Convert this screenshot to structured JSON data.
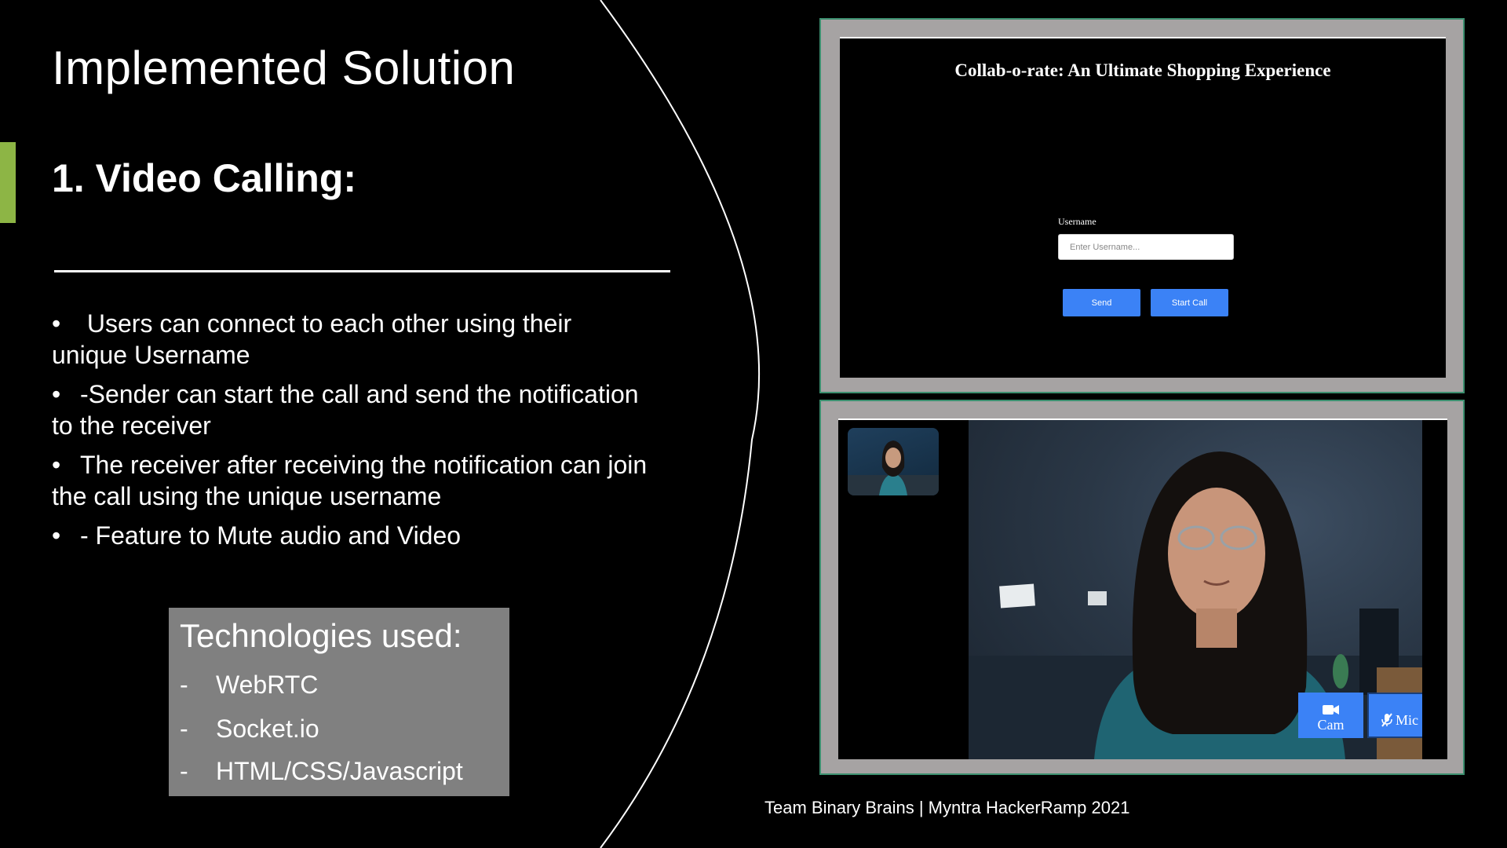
{
  "slide": {
    "title": "Implemented Solution",
    "subtitle": "1. Video Calling:",
    "bullets": [
      "  Users can connect to each other using their unique Username",
      "-Sender can start the call and send the notification to the receiver",
      "The receiver after receiving the notification can join the call using the unique username",
      "- Feature to Mute audio and Video"
    ],
    "bullet_char": "•",
    "tech": {
      "title": "Technologies used:",
      "items": [
        "WebRTC",
        "Socket.io",
        "HTML/CSS/Javascript"
      ],
      "dash": "-"
    },
    "footer": "Team Binary Brains | Myntra HackerRamp 2021"
  },
  "login_screen": {
    "title": "Collab-o-rate: An Ultimate Shopping Experience",
    "username_label": "Username",
    "username_placeholder": "Enter Username...",
    "send_label": "Send",
    "start_call_label": "Start Call"
  },
  "call_screen": {
    "cam_label": "Cam",
    "mic_label": "Mic",
    "cam_icon": "video-camera-icon",
    "mic_icon": "microphone-muted-icon"
  },
  "colors": {
    "accent": "#8db545",
    "button_blue": "#3b82f6",
    "frame_gray": "#a6a3a3",
    "tech_box": "#808080"
  }
}
